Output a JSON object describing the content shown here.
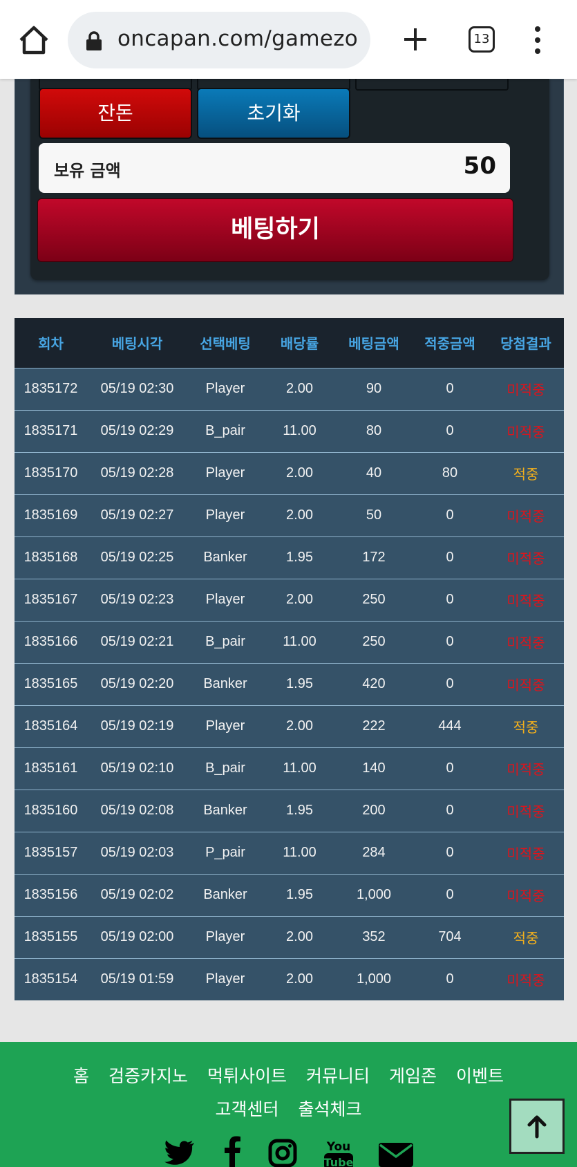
{
  "browser": {
    "url": "oncapan.com/gamezo",
    "tab_count": "13"
  },
  "panel": {
    "buttons": [
      {
        "label": "잔돈",
        "color": "#c20808"
      },
      {
        "label": "초기화",
        "color": "#0a6aa0"
      }
    ],
    "balance_label": "보유 금액",
    "balance_value": "50",
    "bet_button": "베팅하기"
  },
  "table": {
    "headers": [
      "회차",
      "베팅시각",
      "선택베팅",
      "배당률",
      "베팅금액",
      "적중금액",
      "당첨결과"
    ],
    "rows": [
      {
        "round": "1835172",
        "time": "05/19 02:30",
        "choice": "Player",
        "odds": "2.00",
        "bet": "90",
        "payout": "0",
        "result": "미적중",
        "status": "miss"
      },
      {
        "round": "1835171",
        "time": "05/19 02:29",
        "choice": "B_pair",
        "odds": "11.00",
        "bet": "80",
        "payout": "0",
        "result": "미적중",
        "status": "miss"
      },
      {
        "round": "1835170",
        "time": "05/19 02:28",
        "choice": "Player",
        "odds": "2.00",
        "bet": "40",
        "payout": "80",
        "result": "적중",
        "status": "hit"
      },
      {
        "round": "1835169",
        "time": "05/19 02:27",
        "choice": "Player",
        "odds": "2.00",
        "bet": "50",
        "payout": "0",
        "result": "미적중",
        "status": "miss"
      },
      {
        "round": "1835168",
        "time": "05/19 02:25",
        "choice": "Banker",
        "odds": "1.95",
        "bet": "172",
        "payout": "0",
        "result": "미적중",
        "status": "miss"
      },
      {
        "round": "1835167",
        "time": "05/19 02:23",
        "choice": "Player",
        "odds": "2.00",
        "bet": "250",
        "payout": "0",
        "result": "미적중",
        "status": "miss"
      },
      {
        "round": "1835166",
        "time": "05/19 02:21",
        "choice": "B_pair",
        "odds": "11.00",
        "bet": "250",
        "payout": "0",
        "result": "미적중",
        "status": "miss"
      },
      {
        "round": "1835165",
        "time": "05/19 02:20",
        "choice": "Banker",
        "odds": "1.95",
        "bet": "420",
        "payout": "0",
        "result": "미적중",
        "status": "miss"
      },
      {
        "round": "1835164",
        "time": "05/19 02:19",
        "choice": "Player",
        "odds": "2.00",
        "bet": "222",
        "payout": "444",
        "result": "적중",
        "status": "hit"
      },
      {
        "round": "1835161",
        "time": "05/19 02:10",
        "choice": "B_pair",
        "odds": "11.00",
        "bet": "140",
        "payout": "0",
        "result": "미적중",
        "status": "miss"
      },
      {
        "round": "1835160",
        "time": "05/19 02:08",
        "choice": "Banker",
        "odds": "1.95",
        "bet": "200",
        "payout": "0",
        "result": "미적중",
        "status": "miss"
      },
      {
        "round": "1835157",
        "time": "05/19 02:03",
        "choice": "P_pair",
        "odds": "11.00",
        "bet": "284",
        "payout": "0",
        "result": "미적중",
        "status": "miss"
      },
      {
        "round": "1835156",
        "time": "05/19 02:02",
        "choice": "Banker",
        "odds": "1.95",
        "bet": "1,000",
        "payout": "0",
        "result": "미적중",
        "status": "miss"
      },
      {
        "round": "1835155",
        "time": "05/19 02:00",
        "choice": "Player",
        "odds": "2.00",
        "bet": "352",
        "payout": "704",
        "result": "적중",
        "status": "hit"
      },
      {
        "round": "1835154",
        "time": "05/19 01:59",
        "choice": "Player",
        "odds": "2.00",
        "bet": "1,000",
        "payout": "0",
        "result": "미적중",
        "status": "miss"
      }
    ]
  },
  "footer": {
    "links": [
      "홈",
      "검증카지노",
      "먹튀사이트",
      "커뮤니티",
      "게임존",
      "이벤트",
      "고객센터",
      "출석체크"
    ],
    "social_icons": [
      "twitter-icon",
      "facebook-icon",
      "instagram-icon",
      "youtube-icon",
      "mail-icon"
    ],
    "youtube_text": [
      "You",
      "Tube"
    ]
  },
  "colors": {
    "miss": "#e0131a",
    "hit": "#f5b11b",
    "header_text": "#47a5e3",
    "row_bg": "#355268",
    "footer_bg": "#1ea354"
  }
}
